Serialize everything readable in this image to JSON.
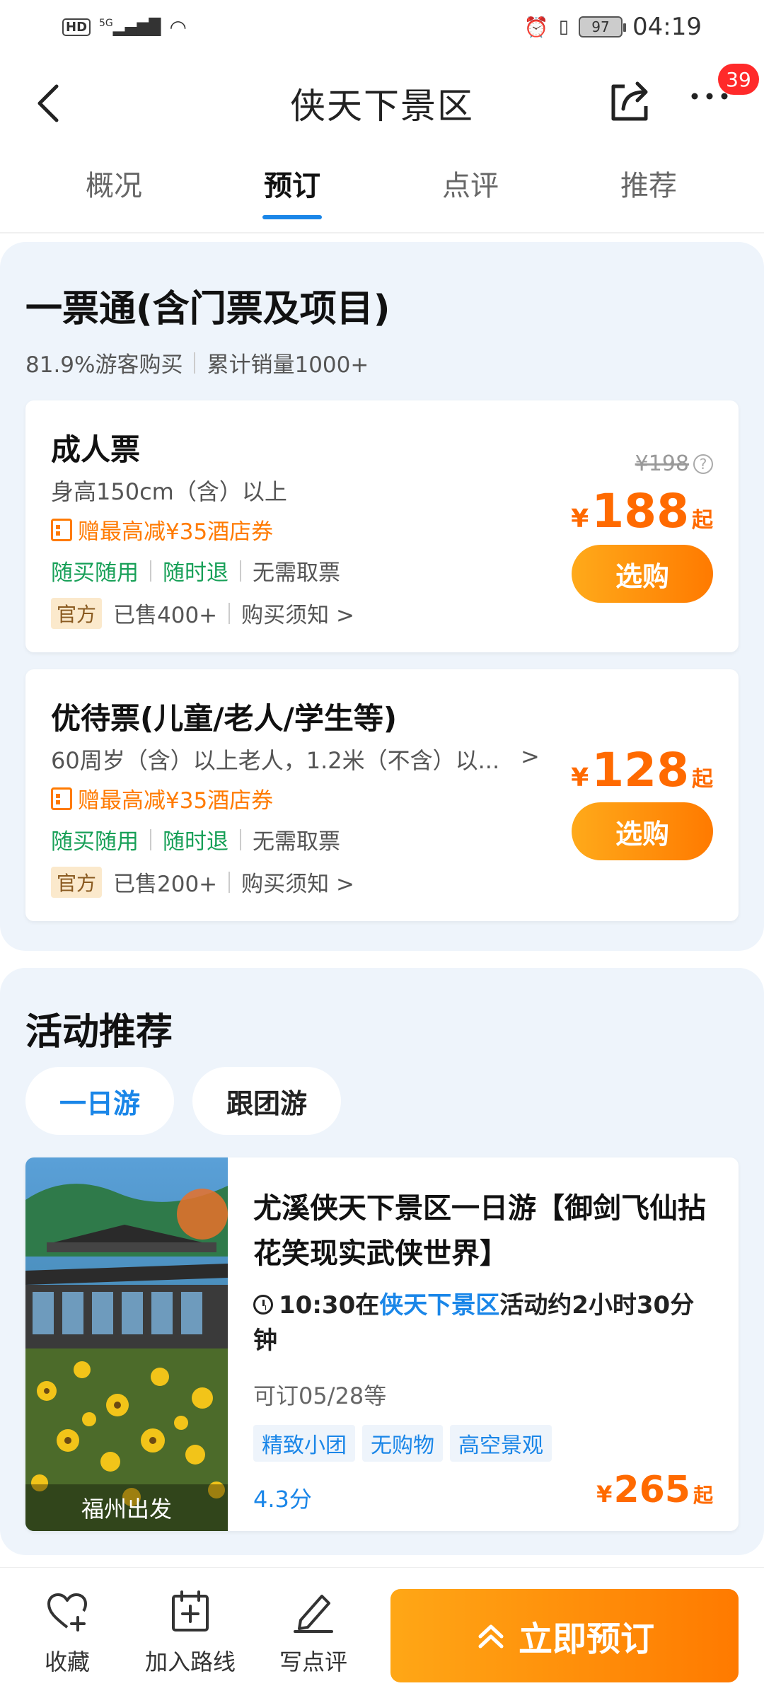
{
  "status_bar": {
    "hd": "HD",
    "network": "5G",
    "battery": "97",
    "time": "04:19"
  },
  "header": {
    "title": "侠天下景区",
    "badge_count": "39",
    "icons": [
      "back-arrow-icon",
      "share-icon",
      "more-icon"
    ]
  },
  "tabs": [
    {
      "label": "概况",
      "active": false
    },
    {
      "label": "预订",
      "active": true
    },
    {
      "label": "点评",
      "active": false
    },
    {
      "label": "推荐",
      "active": false
    }
  ],
  "ticket_section": {
    "title": "一票通(含门票及项目)",
    "stat_buy_rate": "81.9%游客购买",
    "stat_sales": "累计销量1000+",
    "tickets": [
      {
        "name": "成人票",
        "desc": "身高150cm（含）以上",
        "coupon": "赠最高减¥35酒店券",
        "tag1": "随买随用",
        "tag2": "随时退",
        "tag3": "无需取票",
        "official": "官方",
        "sold": "已售400+",
        "notice": "购买须知 >",
        "original_price": "¥198",
        "currency": "¥",
        "price": "188",
        "price_suffix": "起",
        "buy_label": "选购"
      },
      {
        "name": "优待票(儿童/老人/学生等)",
        "desc": "60周岁（含）以上老人，1.2米（不含）以...",
        "desc_arrow": ">",
        "coupon": "赠最高减¥35酒店券",
        "tag1": "随买随用",
        "tag2": "随时退",
        "tag3": "无需取票",
        "official": "官方",
        "sold": "已售200+",
        "notice": "购买须知 >",
        "currency": "¥",
        "price": "128",
        "price_suffix": "起",
        "buy_label": "选购"
      }
    ]
  },
  "activity_section": {
    "title": "活动推荐",
    "chips": [
      {
        "label": "一日游",
        "active": true
      },
      {
        "label": "跟团游",
        "active": false
      }
    ],
    "card": {
      "image_caption": "福州出发",
      "title": "尤溪侠天下景区一日游【御剑飞仙拈花笑现实武侠世界】",
      "time_prefix": "10:30在",
      "place": "侠天下景区",
      "time_suffix": "活动约2小时30分钟",
      "availability": "可订05/28等",
      "tags": [
        "精致小团",
        "无购物",
        "高空景观"
      ],
      "rating": "4.3分",
      "currency": "¥",
      "price": "265",
      "price_suffix": "起"
    }
  },
  "bottom_bar": {
    "favorite": "收藏",
    "add_route": "加入路线",
    "write_review": "写点评",
    "book_now": "立即预订"
  },
  "colors": {
    "accent_blue": "#1a86e8",
    "price_orange": "#ff6a00",
    "tag_green": "#18a058",
    "badge_red": "#ff2a2a"
  }
}
